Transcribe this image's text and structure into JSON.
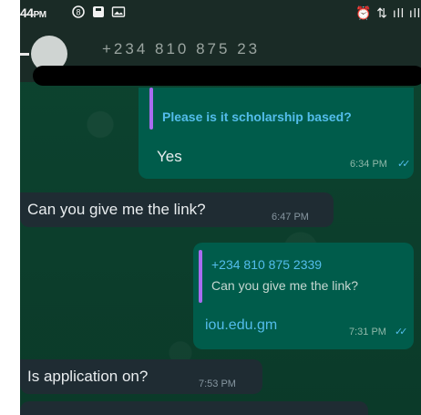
{
  "status_bar": {
    "time": "44",
    "ampm": "PM",
    "right_icons_text": "⏰ ⇅ ıll ıll"
  },
  "header": {
    "contact_partial": "+234 810 875 23"
  },
  "messages": [
    {
      "direction": "outgoing",
      "quoted_text": "Please is it scholarship based?",
      "text": "Yes",
      "time": "6:34 PM",
      "ticks": "✓✓"
    },
    {
      "direction": "incoming",
      "text": "Can you give me the link?",
      "time": "6:47 PM"
    },
    {
      "direction": "outgoing",
      "quoted_name": "+234 810 875 2339",
      "quoted_text": "Can you give me the link?",
      "text": "iou.edu.gm",
      "time": "7:31 PM",
      "ticks": "✓✓"
    },
    {
      "direction": "incoming",
      "text": "Is application on?",
      "time": "7:53 PM"
    }
  ],
  "colors": {
    "wallpaper": "#0c3d2b",
    "incoming_bubble": "#1f2c33",
    "outgoing_bubble": "#005c4b",
    "quote_accent": "#a86cf0",
    "link": "#53bdeb"
  }
}
